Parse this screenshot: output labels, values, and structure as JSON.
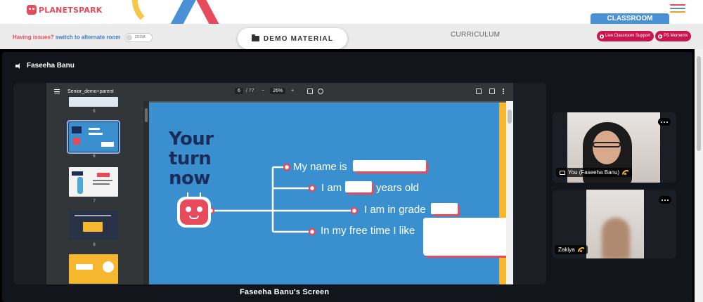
{
  "header": {
    "logo_text": "PLANETSPARK",
    "classroom_tab": "CLASSROOM"
  },
  "subbar": {
    "issues_question": "Having issues?",
    "issues_link": "switch to alternate room",
    "zoom_toggle_label": "ZOOM",
    "demo_material_label": "DEMO MATERIAL",
    "curriculum_label": "CURRICULUM",
    "live_support_label": "Live Classroom Support",
    "ps_moments_label": "PS Moments"
  },
  "stage": {
    "presenter_name": "Faseeha Banu",
    "share_label": "Faseeha Banu's Screen"
  },
  "pdf_viewer": {
    "file_title": "Senior_demo+parent",
    "current_page": "6",
    "total_pages": "/ 77",
    "zoom_level": "26%",
    "zoom_minus": "−",
    "zoom_plus": "+",
    "thumbnail_labels": [
      "5",
      "6",
      "7",
      "8"
    ]
  },
  "slide": {
    "heading_line1": "Your",
    "heading_line2": "turn",
    "heading_line3": "now",
    "prompts": [
      "My name is",
      "I am",
      "years old",
      "I am in grade",
      "In my free time I like"
    ]
  },
  "participants": [
    {
      "name": "You (Faseeha Banu)"
    },
    {
      "name": "Zakiya"
    }
  ],
  "colors": {
    "brand_red": "#e64a5b",
    "brand_blue": "#4a90d6",
    "slide_blue": "#3a8fce",
    "accent_yellow": "#f6b72f",
    "pill_magenta": "#c8174f",
    "stage_dark": "#13151c"
  }
}
